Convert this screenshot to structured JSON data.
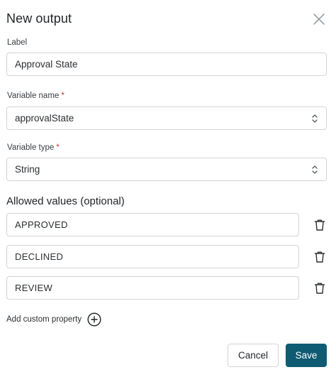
{
  "dialog": {
    "title": "New output",
    "close_icon": "close-icon"
  },
  "label_field": {
    "label": "Label",
    "value": "Approval State"
  },
  "variable_name": {
    "label": "Variable name",
    "required_mark": "*",
    "value": "approvalState",
    "icon": "chevron-updown-icon"
  },
  "variable_type": {
    "label": "Variable type",
    "required_mark": "*",
    "value": "String",
    "icon": "chevron-updown-icon"
  },
  "allowed_values": {
    "title": "Allowed values (optional)",
    "items": [
      {
        "value": "APPROVED"
      },
      {
        "value": "DECLINED"
      },
      {
        "value": "REVIEW"
      }
    ],
    "delete_icon": "trash-icon"
  },
  "custom_property": {
    "label": "Add custom property",
    "icon": "plus-circle-icon"
  },
  "actions": {
    "cancel_label": "Cancel",
    "save_label": "Save"
  },
  "colors": {
    "primary": "#0e5b73",
    "required": "#d32f2f",
    "border": "#d0d4d9"
  }
}
